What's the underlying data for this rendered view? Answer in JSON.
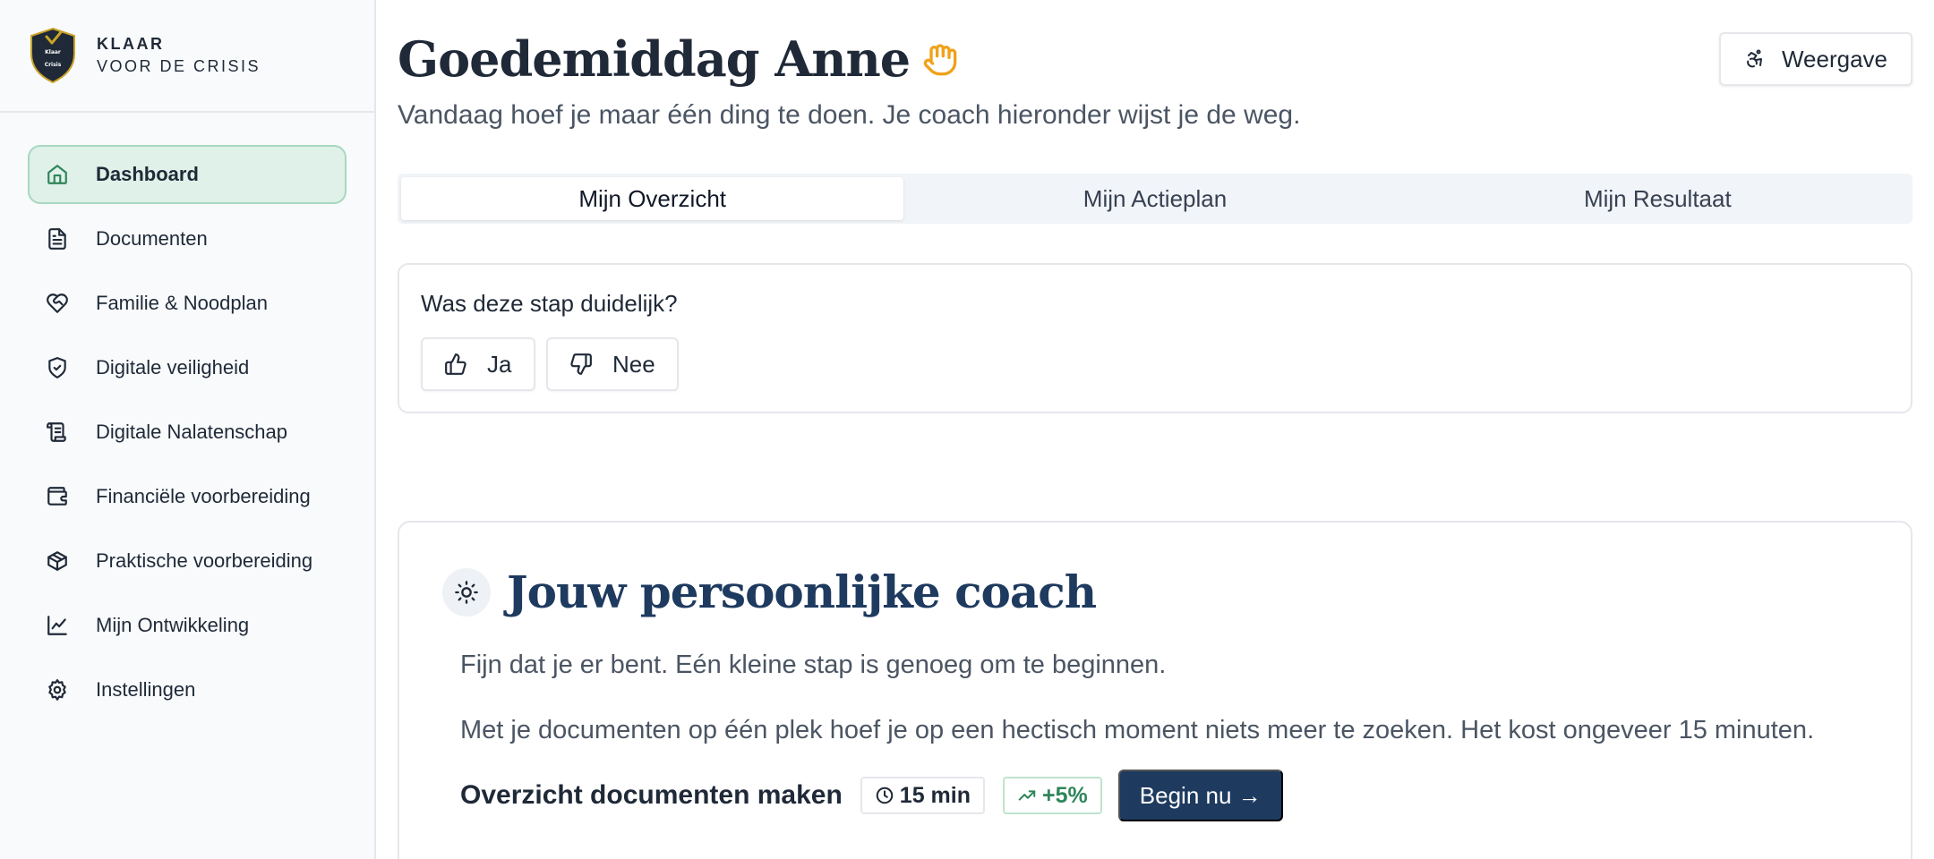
{
  "brand": {
    "name_line1": "KLAAR",
    "name_line2": "VOOR DE CRISIS",
    "logo_text_line1": "Klaar",
    "logo_text_line2": "Crisis"
  },
  "sidebar": {
    "items": [
      {
        "label": "Dashboard",
        "icon": "home-icon",
        "active": true
      },
      {
        "label": "Documenten",
        "icon": "document-icon"
      },
      {
        "label": "Familie & Noodplan",
        "icon": "heart-handshake-icon"
      },
      {
        "label": "Digitale veiligheid",
        "icon": "shield-check-icon"
      },
      {
        "label": "Digitale Nalatenschap",
        "icon": "scroll-icon"
      },
      {
        "label": "Financiële voorbereiding",
        "icon": "wallet-icon"
      },
      {
        "label": "Praktische voorbereiding",
        "icon": "package-icon"
      },
      {
        "label": "Mijn Ontwikkeling",
        "icon": "chart-line-icon"
      },
      {
        "label": "Instellingen",
        "icon": "gear-icon"
      }
    ]
  },
  "header": {
    "greeting": "Goedemiddag Anne",
    "subtitle": "Vandaag hoef je maar één ding te doen. Je coach hieronder wijst je de weg.",
    "view_button": "Weergave"
  },
  "tabs": [
    {
      "label": "Mijn Overzicht",
      "active": true
    },
    {
      "label": "Mijn Actieplan"
    },
    {
      "label": "Mijn Resultaat"
    }
  ],
  "feedback": {
    "question": "Was deze stap duidelijk?",
    "yes_label": "Ja",
    "no_label": "Nee"
  },
  "coach": {
    "title": "Jouw persoonlijke coach",
    "paragraph1": "Fijn dat je er bent. Eén kleine stap is genoeg om te beginnen.",
    "paragraph2": "Met je documenten op één plek hoef je op een hectisch moment niets meer te zoeken. Het kost ongeveer 15 minuten.",
    "task": {
      "name": "Overzicht documenten maken",
      "duration": "15 min",
      "gain": "+5%",
      "button": "Begin nu →"
    }
  },
  "colors": {
    "accent_navy": "#1e3a5f",
    "active_nav_bg": "#dff1e9",
    "success_green": "#2f855a",
    "wave_orange": "#f0a11a"
  }
}
